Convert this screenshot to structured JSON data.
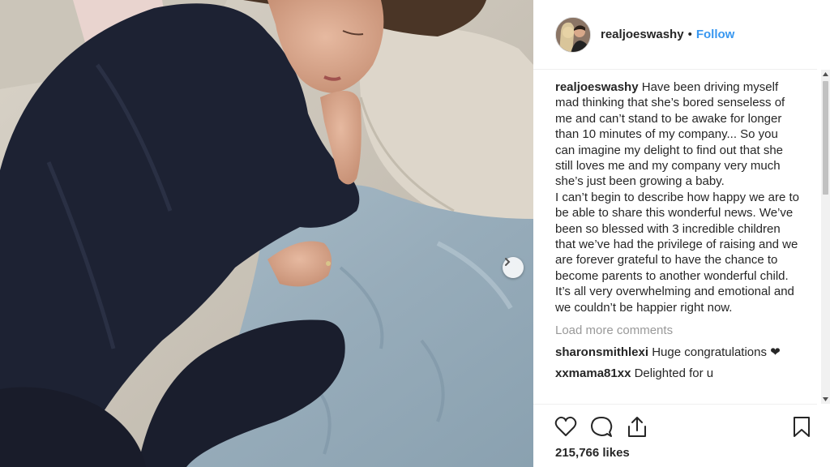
{
  "post": {
    "photo_description_icon": "photo",
    "next_icon": "chevron-right-icon"
  },
  "header": {
    "username": "realjoeswashy",
    "separator": "•",
    "follow_label": "Follow"
  },
  "caption": {
    "username": "realjoeswashy",
    "text": " Have been driving myself mad thinking that she’s bored senseless of me and can’t stand to be awake for longer than 10 minutes of my company... So you can imagine my delight to find out that she still loves me and my company very much she’s just been growing a baby.\nI can’t begin to describe how happy we are to be able to share this wonderful news. We’ve been so blessed with 3 incredible children that we’ve had the privilege of raising and we are forever grateful to have the chance to become parents to another wonderful child. It’s all very overwhelming and emotional and we couldn’t be happier right now."
  },
  "load_more_label": "Load more comments",
  "comments": [
    {
      "username": "sharonsmithlexi",
      "text": " Huge congratulations ❤"
    },
    {
      "username": "xxmama81xx",
      "text": " Delighted for u"
    }
  ],
  "actions": {
    "like_icon": "heart-icon",
    "comment_icon": "comment-icon",
    "share_icon": "share-icon",
    "save_icon": "bookmark-icon"
  },
  "likes_label": "215,766 likes",
  "colors": {
    "follow": "#3897f0",
    "muted": "#999999",
    "text": "#262626"
  }
}
